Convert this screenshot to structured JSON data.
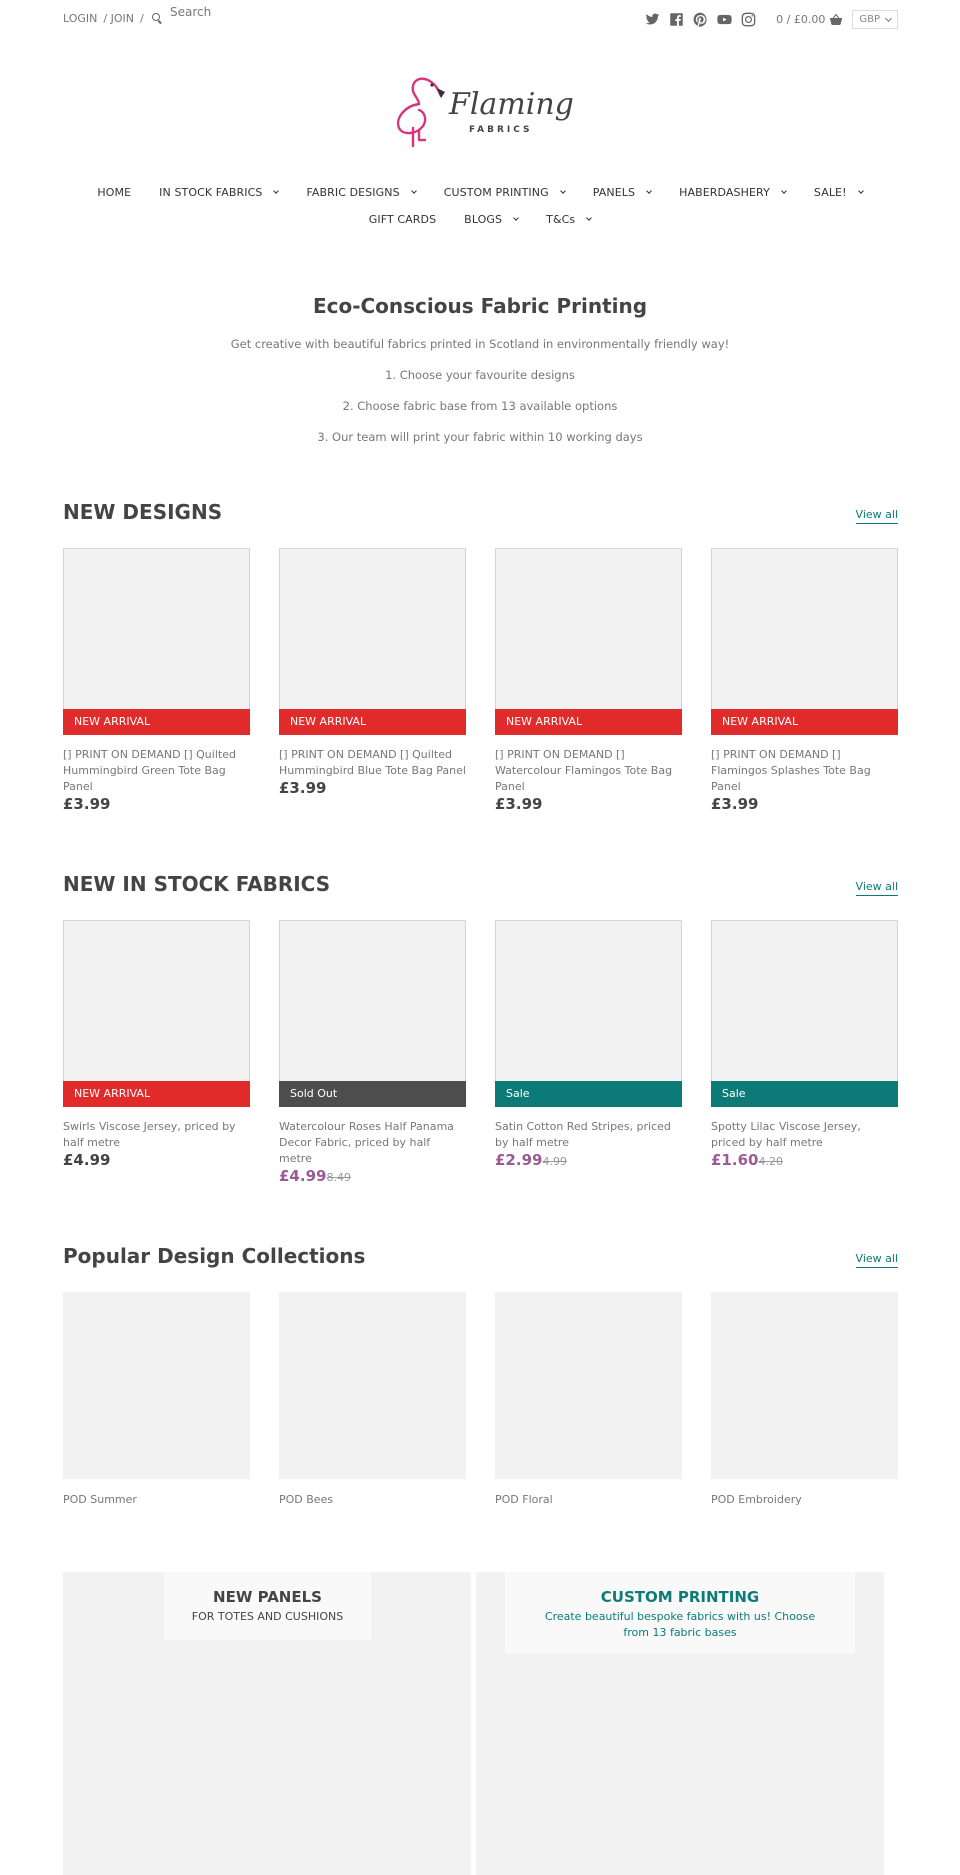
{
  "topbar": {
    "login": "LOGIN",
    "join": "/ JOIN",
    "sep": "/",
    "search_placeholder": "Search",
    "social_icons": [
      "twitter-icon",
      "facebook-icon",
      "pinterest-icon",
      "youtube-icon",
      "instagram-icon"
    ],
    "cart": "0 / £0.00",
    "currency": "GBP"
  },
  "logo": {
    "name": "Flamingo",
    "sub": "FABRICS",
    "accent": "#d9357e"
  },
  "nav": {
    "row1": [
      {
        "label": "HOME",
        "dropdown": false
      },
      {
        "label": "IN STOCK FABRICS",
        "dropdown": true
      },
      {
        "label": "FABRIC DESIGNS",
        "dropdown": true
      },
      {
        "label": "CUSTOM PRINTING",
        "dropdown": true
      },
      {
        "label": "PANELS",
        "dropdown": true
      },
      {
        "label": "HABERDASHERY",
        "dropdown": true
      },
      {
        "label": "SALE!",
        "dropdown": true
      }
    ],
    "row2": [
      {
        "label": "GIFT CARDS",
        "dropdown": false
      },
      {
        "label": "BLOGS",
        "dropdown": true
      },
      {
        "label": "T&Cs",
        "dropdown": true
      }
    ]
  },
  "intro": {
    "title": "Eco-Conscious Fabric Printing",
    "line1": "Get creative with beautiful fabrics printed in Scotland in environmentally friendly way!",
    "line2": "1. Choose your favourite designs",
    "line3": "2. Choose fabric base from 13 available options",
    "line4": "3. Our team will print your fabric within 10 working days"
  },
  "new_designs": {
    "title": "NEW DESIGNS",
    "view_all": "View all",
    "products": [
      {
        "badge": "NEW ARRIVAL",
        "title": "[] PRINT ON DEMAND [] Quilted Hummingbird Green Tote Bag Panel",
        "price": "£3.99"
      },
      {
        "badge": "NEW ARRIVAL",
        "title": "[] PRINT ON DEMAND [] Quilted Hummingbird Blue Tote Bag Panel",
        "price": "£3.99"
      },
      {
        "badge": "NEW ARRIVAL",
        "title": "[] PRINT ON DEMAND [] Watercolour Flamingos Tote Bag Panel",
        "price": "£3.99"
      },
      {
        "badge": "NEW ARRIVAL",
        "title": "[] PRINT ON DEMAND [] Flamingos Splashes Tote Bag Panel",
        "price": "£3.99"
      }
    ]
  },
  "new_stock": {
    "title": "NEW IN STOCK FABRICS",
    "view_all": "View all",
    "products": [
      {
        "badge": "NEW ARRIVAL",
        "title": "Swirls Viscose Jersey, priced by half metre",
        "price": "£4.99",
        "was": ""
      },
      {
        "badge": "Sold Out",
        "title": "Watercolour Roses Half Panama Decor Fabric, priced by half metre",
        "price": "£4.99",
        "was": "8.49"
      },
      {
        "badge": "Sale",
        "title": "Satin Cotton Red Stripes, priced by half metre",
        "price": "£2.99",
        "was": "4.99"
      },
      {
        "badge": "Sale",
        "title": "Spotty Lilac Viscose Jersey, priced by half metre",
        "price": "£1.60",
        "was": "4.20"
      }
    ]
  },
  "collections": {
    "title": "Popular Design Collections",
    "view_all": "View all",
    "items": [
      "POD Summer",
      "POD Bees",
      "POD Floral",
      "POD Embroidery"
    ]
  },
  "promos": {
    "panels": {
      "title": "NEW PANELS",
      "subtitle": "FOR TOTES AND CUSHIONS"
    },
    "custom": {
      "title": "CUSTOM PRINTING",
      "subtitle": "Create beautiful bespoke fabrics with us! Choose from 13 fabric bases"
    }
  },
  "colors": {
    "new_arrival": "#e12b2b",
    "sold_out": "#4d4d4d",
    "sale": "#0c7b77",
    "sale_price": "#9b5a96",
    "link": "#0c7b77"
  }
}
